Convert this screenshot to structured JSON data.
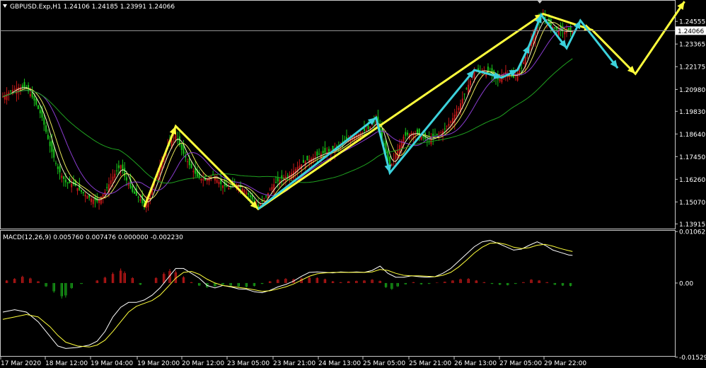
{
  "header": {
    "symbol_line": "GBPUSD.Exp,H1  1.24106 1.24185 1.23991 1.24066",
    "macd_line": "MACD(12,26,9) 0.005760 0.007476 0.000000 -0.002230"
  },
  "colors": {
    "background": "#000000",
    "frame": "#c8c8c8",
    "bull_candle": "#c21818",
    "bear_candle": "#18c21a",
    "ma_fast": "#f5f5c0",
    "ma_mid": "#e8e85a",
    "ma_slow": "#8a3cd0",
    "ma_long": "#1fa01f",
    "wave_yellow": "#ffff3c",
    "wave_cyan": "#3cd2dc",
    "macd_pos": "#c21818",
    "macd_neg": "#18a018",
    "macd_main": "#ffffff",
    "macd_signal": "#ffff3c"
  },
  "chart_data": [
    {
      "type": "candlestick",
      "title": "GBPUSD.Exp,H1",
      "ohlc_last": {
        "open": 1.24106,
        "high": 1.24185,
        "low": 1.23991,
        "close": 1.24066
      },
      "current_price": "1.24066",
      "ylim": [
        1.1367,
        1.2512
      ],
      "y_ticks": [
        "1.24555",
        "1.23365",
        "1.22175",
        "1.20980",
        "1.19830",
        "1.18640",
        "1.17450",
        "1.16260",
        "1.15070",
        "1.13915"
      ],
      "x_ticks": [
        "17 Mar 2020",
        "18 Mar 12:00",
        "19 Mar 04:00",
        "19 Mar 20:00",
        "20 Mar 12:00",
        "23 Mar 05:00",
        "23 Mar 21:00",
        "24 Mar 13:00",
        "25 Mar 05:00",
        "25 Mar 21:00",
        "26 Mar 13:00",
        "27 Mar 05:00",
        "29 Mar 22:00"
      ],
      "close_path": [
        [
          0,
          1.206
        ],
        [
          4,
          1.209
        ],
        [
          8,
          1.211
        ],
        [
          12,
          1.2105
        ],
        [
          16,
          1.204
        ],
        [
          20,
          1.195
        ],
        [
          24,
          1.18
        ],
        [
          28,
          1.168
        ],
        [
          32,
          1.161
        ],
        [
          36,
          1.16
        ],
        [
          40,
          1.156
        ],
        [
          44,
          1.153
        ],
        [
          48,
          1.151
        ],
        [
          52,
          1.156
        ],
        [
          56,
          1.164
        ],
        [
          60,
          1.17
        ],
        [
          62,
          1.164
        ],
        [
          66,
          1.156
        ],
        [
          70,
          1.152
        ],
        [
          72,
          1.148
        ],
        [
          76,
          1.158
        ],
        [
          80,
          1.17
        ],
        [
          84,
          1.18
        ],
        [
          88,
          1.186
        ],
        [
          91,
          1.178
        ],
        [
          95,
          1.17
        ],
        [
          99,
          1.164
        ],
        [
          103,
          1.162
        ],
        [
          107,
          1.165
        ],
        [
          111,
          1.16
        ],
        [
          115,
          1.158
        ],
        [
          119,
          1.16
        ],
        [
          123,
          1.157
        ],
        [
          127,
          1.152
        ],
        [
          130,
          1.148
        ],
        [
          134,
          1.154
        ],
        [
          138,
          1.16
        ],
        [
          142,
          1.163
        ],
        [
          146,
          1.165
        ],
        [
          150,
          1.169
        ],
        [
          154,
          1.172
        ],
        [
          158,
          1.174
        ],
        [
          162,
          1.176
        ],
        [
          166,
          1.177
        ],
        [
          170,
          1.179
        ],
        [
          174,
          1.183
        ],
        [
          178,
          1.185
        ],
        [
          182,
          1.187
        ],
        [
          186,
          1.189
        ],
        [
          190,
          1.194
        ],
        [
          192,
          1.188
        ],
        [
          195,
          1.176
        ],
        [
          197,
          1.168
        ],
        [
          200,
          1.176
        ],
        [
          204,
          1.185
        ],
        [
          208,
          1.187
        ],
        [
          212,
          1.186
        ],
        [
          216,
          1.183
        ],
        [
          220,
          1.185
        ],
        [
          224,
          1.188
        ],
        [
          228,
          1.193
        ],
        [
          232,
          1.2
        ],
        [
          236,
          1.21
        ],
        [
          240,
          1.219
        ],
        [
          244,
          1.22
        ],
        [
          248,
          1.218
        ],
        [
          252,
          1.215
        ],
        [
          256,
          1.219
        ],
        [
          260,
          1.216
        ],
        [
          264,
          1.221
        ],
        [
          268,
          1.233
        ],
        [
          272,
          1.244
        ],
        [
          275,
          1.248
        ],
        [
          278,
          1.244
        ],
        [
          282,
          1.241
        ],
        [
          286,
          1.24
        ],
        [
          290,
          1.2407
        ]
      ],
      "wave_yellow": [
        [
          72,
          1.148
        ],
        [
          88,
          1.1905
        ],
        [
          130,
          1.147
        ],
        [
          275,
          1.2495
        ],
        [
          300,
          1.241
        ],
        [
          322,
          1.218
        ],
        [
          347,
          1.256
        ]
      ],
      "wave_cyan": [
        [
          130,
          1.147
        ],
        [
          190,
          1.195
        ],
        [
          197,
          1.166
        ],
        [
          240,
          1.22
        ],
        [
          254,
          1.216
        ],
        [
          262,
          1.22
        ],
        [
          268,
          1.233
        ],
        [
          274,
          1.249
        ],
        [
          287,
          1.2315
        ],
        [
          294,
          1.246
        ],
        [
          313,
          1.221
        ]
      ]
    },
    {
      "type": "histogram+line",
      "title": "MACD(12,26,9)",
      "values": {
        "macd": 0.00576,
        "signal": 0.007476,
        "histogram_a": 0.0,
        "histogram_b": -0.00223
      },
      "ylim": [
        -0.0152,
        0.0108
      ],
      "y_ticks": [
        "0.01062",
        "0.00",
        "-0.01529"
      ],
      "histogram": [
        [
          2,
          0.0006
        ],
        [
          6,
          0.001
        ],
        [
          10,
          0.0015
        ],
        [
          14,
          0.0011
        ],
        [
          18,
          0.0004
        ],
        [
          22,
          -0.0008
        ],
        [
          26,
          -0.002
        ],
        [
          30,
          -0.0032
        ],
        [
          32,
          -0.003
        ],
        [
          35,
          -0.0012
        ],
        [
          40,
          -0.0002
        ],
        [
          44,
          0.0
        ],
        [
          48,
          0.0006
        ],
        [
          52,
          0.0013
        ],
        [
          56,
          0.0022
        ],
        [
          60,
          0.003
        ],
        [
          62,
          0.0024
        ],
        [
          66,
          0.0012
        ],
        [
          70,
          -0.0004
        ],
        [
          74,
          0.0
        ],
        [
          78,
          0.0012
        ],
        [
          82,
          0.0022
        ],
        [
          85,
          0.0029
        ],
        [
          88,
          0.0026
        ],
        [
          92,
          0.0014
        ],
        [
          96,
          0.0002
        ],
        [
          100,
          -0.0006
        ],
        [
          104,
          -0.001
        ],
        [
          108,
          -0.0008
        ],
        [
          112,
          -0.0004
        ],
        [
          116,
          -0.0006
        ],
        [
          120,
          -0.0008
        ],
        [
          124,
          -0.0009
        ],
        [
          128,
          -0.0007
        ],
        [
          132,
          -0.0002
        ],
        [
          136,
          0.0004
        ],
        [
          140,
          0.0008
        ],
        [
          144,
          0.001
        ],
        [
          148,
          0.0009
        ],
        [
          152,
          0.0011
        ],
        [
          156,
          0.0013
        ],
        [
          160,
          0.0012
        ],
        [
          164,
          0.0009
        ],
        [
          168,
          0.0004
        ],
        [
          172,
          0.0002
        ],
        [
          176,
          0.0004
        ],
        [
          180,
          0.0005
        ],
        [
          184,
          0.0006
        ],
        [
          188,
          0.0008
        ],
        [
          192,
          0.0005
        ],
        [
          195,
          -0.001
        ],
        [
          198,
          -0.0014
        ],
        [
          201,
          -0.0008
        ],
        [
          205,
          -0.0003
        ],
        [
          209,
          0.0002
        ],
        [
          213,
          -0.0003
        ],
        [
          217,
          -0.0002
        ],
        [
          221,
          0.0001
        ],
        [
          225,
          0.0003
        ],
        [
          229,
          0.0006
        ],
        [
          233,
          0.0009
        ],
        [
          237,
          0.001
        ],
        [
          241,
          0.0006
        ],
        [
          245,
          0.0002
        ],
        [
          249,
          -0.0002
        ],
        [
          253,
          -0.0004
        ],
        [
          257,
          -0.0005
        ],
        [
          261,
          -0.0002
        ],
        [
          265,
          0.0002
        ],
        [
          269,
          0.0008
        ],
        [
          273,
          0.0006
        ],
        [
          277,
          0.0002
        ],
        [
          281,
          -0.0004
        ],
        [
          285,
          -0.0006
        ],
        [
          289,
          -0.0007
        ]
      ],
      "macd_path": [
        [
          0,
          -0.006
        ],
        [
          6,
          -0.0055
        ],
        [
          12,
          -0.006
        ],
        [
          18,
          -0.008
        ],
        [
          24,
          -0.011
        ],
        [
          28,
          -0.013
        ],
        [
          32,
          -0.0135
        ],
        [
          38,
          -0.0133
        ],
        [
          44,
          -0.0128
        ],
        [
          48,
          -0.012
        ],
        [
          52,
          -0.01
        ],
        [
          56,
          -0.007
        ],
        [
          60,
          -0.005
        ],
        [
          64,
          -0.004
        ],
        [
          68,
          -0.004
        ],
        [
          72,
          -0.0035
        ],
        [
          76,
          -0.0025
        ],
        [
          80,
          -0.001
        ],
        [
          84,
          0.001
        ],
        [
          88,
          0.003
        ],
        [
          92,
          0.003
        ],
        [
          96,
          0.002
        ],
        [
          100,
          0.001
        ],
        [
          104,
          -0.0005
        ],
        [
          108,
          -0.001
        ],
        [
          112,
          -0.0005
        ],
        [
          116,
          -0.0008
        ],
        [
          120,
          -0.0012
        ],
        [
          124,
          -0.0013
        ],
        [
          128,
          -0.0018
        ],
        [
          132,
          -0.002
        ],
        [
          136,
          -0.0015
        ],
        [
          140,
          -0.0008
        ],
        [
          144,
          -0.0003
        ],
        [
          148,
          0.0004
        ],
        [
          152,
          0.0014
        ],
        [
          156,
          0.0022
        ],
        [
          160,
          0.0023
        ],
        [
          164,
          0.0022
        ],
        [
          168,
          0.0021
        ],
        [
          172,
          0.0023
        ],
        [
          176,
          0.0022
        ],
        [
          180,
          0.0023
        ],
        [
          184,
          0.0022
        ],
        [
          188,
          0.0026
        ],
        [
          192,
          0.0035
        ],
        [
          196,
          0.002
        ],
        [
          200,
          0.0012
        ],
        [
          204,
          0.0012
        ],
        [
          208,
          0.0015
        ],
        [
          212,
          0.0013
        ],
        [
          216,
          0.0012
        ],
        [
          220,
          0.0013
        ],
        [
          224,
          0.002
        ],
        [
          228,
          0.003
        ],
        [
          232,
          0.0045
        ],
        [
          236,
          0.006
        ],
        [
          240,
          0.0075
        ],
        [
          244,
          0.0085
        ],
        [
          248,
          0.0088
        ],
        [
          252,
          0.0082
        ],
        [
          256,
          0.0075
        ],
        [
          260,
          0.0068
        ],
        [
          264,
          0.007
        ],
        [
          268,
          0.0078
        ],
        [
          272,
          0.0085
        ],
        [
          276,
          0.0078
        ],
        [
          280,
          0.0068
        ],
        [
          284,
          0.0063
        ],
        [
          288,
          0.0058
        ],
        [
          290,
          0.0057
        ]
      ],
      "signal_path": [
        [
          0,
          -0.0075
        ],
        [
          6,
          -0.007
        ],
        [
          12,
          -0.0065
        ],
        [
          18,
          -0.007
        ],
        [
          24,
          -0.009
        ],
        [
          28,
          -0.0108
        ],
        [
          32,
          -0.0122
        ],
        [
          38,
          -0.013
        ],
        [
          44,
          -0.0132
        ],
        [
          48,
          -0.0128
        ],
        [
          52,
          -0.0118
        ],
        [
          56,
          -0.01
        ],
        [
          60,
          -0.008
        ],
        [
          64,
          -0.006
        ],
        [
          68,
          -0.0048
        ],
        [
          72,
          -0.0042
        ],
        [
          76,
          -0.0036
        ],
        [
          80,
          -0.0025
        ],
        [
          84,
          -0.0008
        ],
        [
          88,
          0.001
        ],
        [
          92,
          0.0022
        ],
        [
          96,
          0.0024
        ],
        [
          100,
          0.0018
        ],
        [
          104,
          0.0008
        ],
        [
          108,
          0.0
        ],
        [
          112,
          -0.0005
        ],
        [
          116,
          -0.0007
        ],
        [
          120,
          -0.0009
        ],
        [
          124,
          -0.0011
        ],
        [
          128,
          -0.0014
        ],
        [
          132,
          -0.0017
        ],
        [
          136,
          -0.0016
        ],
        [
          140,
          -0.0012
        ],
        [
          144,
          -0.0008
        ],
        [
          148,
          -0.0002
        ],
        [
          152,
          0.0006
        ],
        [
          156,
          0.0014
        ],
        [
          160,
          0.0019
        ],
        [
          164,
          0.0021
        ],
        [
          168,
          0.0022
        ],
        [
          172,
          0.0022
        ],
        [
          176,
          0.0022
        ],
        [
          180,
          0.0022
        ],
        [
          184,
          0.0022
        ],
        [
          188,
          0.0023
        ],
        [
          192,
          0.0028
        ],
        [
          196,
          0.0026
        ],
        [
          200,
          0.002
        ],
        [
          204,
          0.0016
        ],
        [
          208,
          0.0015
        ],
        [
          212,
          0.0015
        ],
        [
          216,
          0.0014
        ],
        [
          220,
          0.0013
        ],
        [
          224,
          0.0016
        ],
        [
          228,
          0.0022
        ],
        [
          232,
          0.0033
        ],
        [
          236,
          0.0047
        ],
        [
          240,
          0.0062
        ],
        [
          244,
          0.0074
        ],
        [
          248,
          0.0082
        ],
        [
          252,
          0.0083
        ],
        [
          256,
          0.008
        ],
        [
          260,
          0.0074
        ],
        [
          264,
          0.0071
        ],
        [
          268,
          0.0073
        ],
        [
          272,
          0.0078
        ],
        [
          276,
          0.008
        ],
        [
          280,
          0.0076
        ],
        [
          284,
          0.0071
        ],
        [
          288,
          0.0067
        ],
        [
          290,
          0.0065
        ]
      ]
    }
  ]
}
